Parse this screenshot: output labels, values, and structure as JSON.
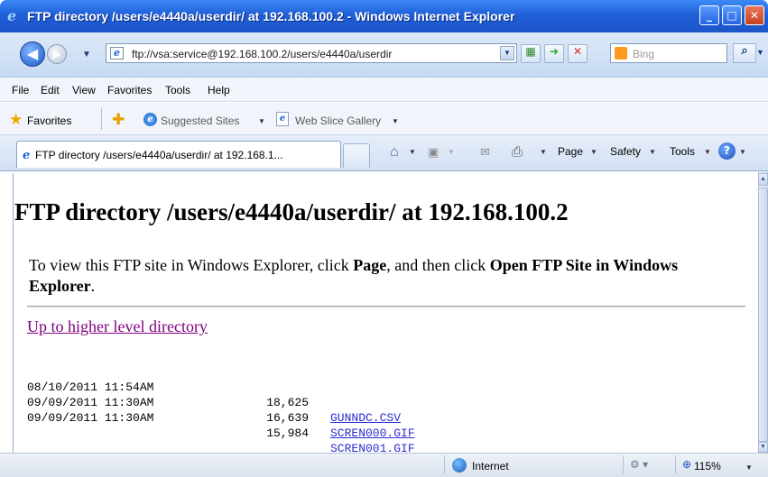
{
  "window": {
    "title": "FTP directory /users/e4440a/userdir/ at 192.168.100.2 - Windows Internet Explorer",
    "controls": {
      "minimize": "_",
      "maximize": "□",
      "close": "✕"
    }
  },
  "address_bar": {
    "url": "ftp://vsa:service@192.168.100.2/users/e4440a/userdir",
    "search_placeholder": "Bing"
  },
  "menu": [
    "File",
    "Edit",
    "View",
    "Favorites",
    "Tools",
    "Help"
  ],
  "favorites_bar": {
    "favorites_label": "Favorites",
    "links": [
      "Suggested Sites",
      "Web Slice Gallery"
    ]
  },
  "tab": {
    "title": "FTP directory /users/e4440a/userdir/ at 192.168.1..."
  },
  "command_bar": {
    "page": "Page",
    "safety": "Safety",
    "tools": "Tools"
  },
  "content": {
    "heading": "FTP directory /users/e4440a/userdir/ at 192.168.100.2",
    "instruction_prefix": "To view this FTP site in Windows Explorer, click ",
    "instruction_page": "Page",
    "instruction_middle": ", and then click ",
    "instruction_open": "Open FTP Site in Windows Explorer",
    "instruction_suffix": ".",
    "up_link": "Up to higher level directory",
    "files": [
      {
        "date": "08/10/2011 11:54AM",
        "size": "18,625",
        "name": "GUNNDC.CSV"
      },
      {
        "date": "09/09/2011 11:30AM",
        "size": "16,639",
        "name": "SCREN000.GIF"
      },
      {
        "date": "09/09/2011 11:30AM",
        "size": "15,984",
        "name": "SCREN001.GIF"
      }
    ]
  },
  "status_bar": {
    "zone": "Internet",
    "zoom": "115%"
  },
  "colors": {
    "titlebar": "#1f5fd8",
    "visited_link": "#800080",
    "file_link": "#2b2bd0"
  }
}
